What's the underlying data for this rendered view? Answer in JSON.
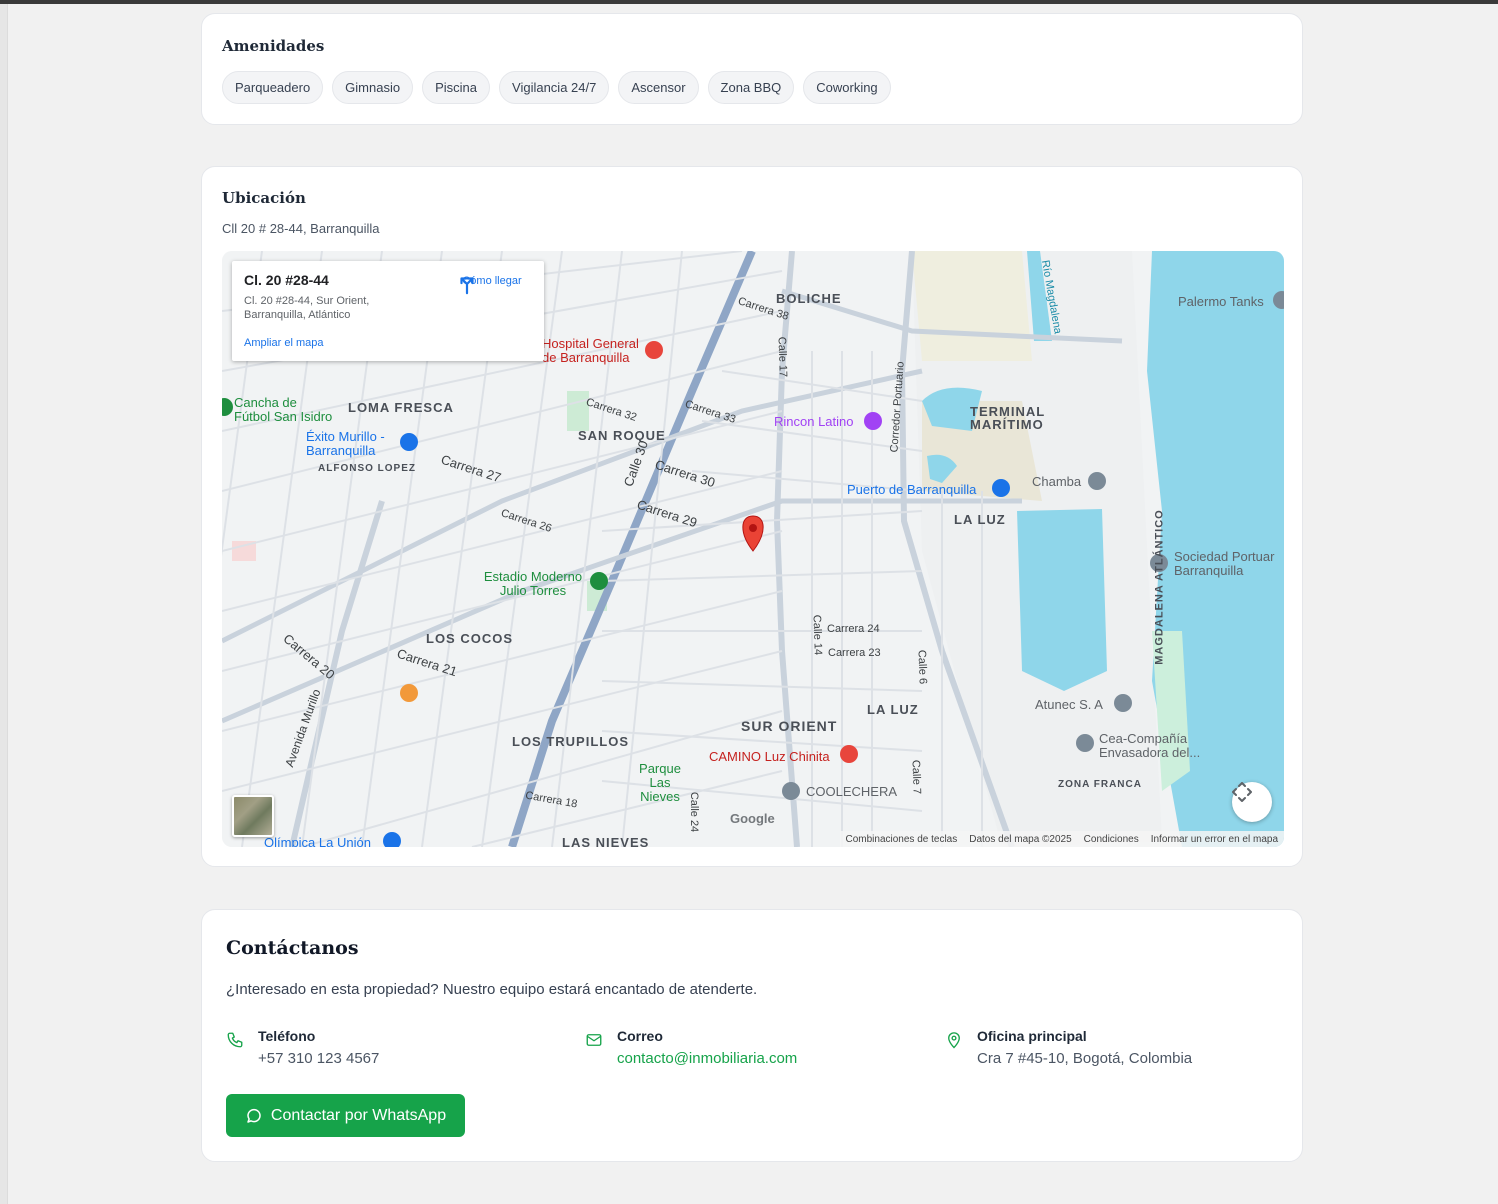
{
  "amenities": {
    "title": "Amenidades",
    "items": [
      "Parqueadero",
      "Gimnasio",
      "Piscina",
      "Vigilancia 24/7",
      "Ascensor",
      "Zona BBQ",
      "Coworking"
    ]
  },
  "location": {
    "title": "Ubicación",
    "address": "Cll 20 # 28-44, Barranquilla",
    "map": {
      "infobox": {
        "title": "Cl. 20 #28-44",
        "address": "Cl. 20 #28-44, Sur Orient, Barranquilla, Atlántico",
        "directions_label": "Cómo llegar",
        "enlarge_label": "Ampliar el mapa"
      },
      "districts": [
        "BOLICHE",
        "LOMA FRESCA",
        "SAN ROQUE",
        "TERMINAL MARÍTIMO",
        "LA LUZ",
        "LOS COCOS",
        "SUR ORIENT",
        "LA LUZ",
        "LOS TRUPILLOS",
        "LAS NIEVES",
        "ALFONSO LOPEZ",
        "ZONA FRANCA"
      ],
      "pois": [
        "Hospital General de Barranquilla",
        "Cancha de Fútbol San Isidro",
        "Éxito Murillo - Barranquilla",
        "Rincon Latino",
        "Puerto de Barranquilla",
        "Chamba",
        "Palermo Tanks",
        "Sociedad Portuar Barranquilla",
        "Estadio Moderno Julio Torres",
        "Atunec S. A",
        "Cea-Compañía Envasadora del...",
        "CAMINO Luz Chinita",
        "COOLECHERA",
        "Parque Las Nieves",
        "Olímpica La Unión"
      ],
      "streets": [
        "Carrera 38",
        "Calle 17",
        "Corredor Portuario",
        "Carrera 30",
        "Carrera 29",
        "Calle 30",
        "Carrera 24",
        "Carrera 23",
        "Carrera 21",
        "Carrera 20",
        "Carrera 18",
        "Calle 24",
        "Calle 14",
        "Calle 6",
        "Calle 7",
        "Carrera 32",
        "Carrera 33",
        "Carrera 27",
        "Carrera 26",
        "Avenida Murillo",
        "Río Magdalena",
        "MAGDALENA ATLÁNTICO"
      ],
      "attribution": [
        "Combinaciones de teclas",
        "Datos del mapa ©2025",
        "Condiciones",
        "Informar un error en el mapa"
      ],
      "logo": "Google"
    }
  },
  "contact": {
    "title": "Contáctanos",
    "subtitle": "¿Interesado en esta propiedad? Nuestro equipo estará encantado de atenderte.",
    "phone_label": "Teléfono",
    "phone_value": "+57 310 123 4567",
    "email_label": "Correo",
    "email_value": "contacto@inmobiliaria.com",
    "office_label": "Oficina principal",
    "office_value": "Cra 7 #45-10, Bogotá, Colombia",
    "whatsapp_label": "Contactar por WhatsApp",
    "accent": "#16a34a"
  }
}
